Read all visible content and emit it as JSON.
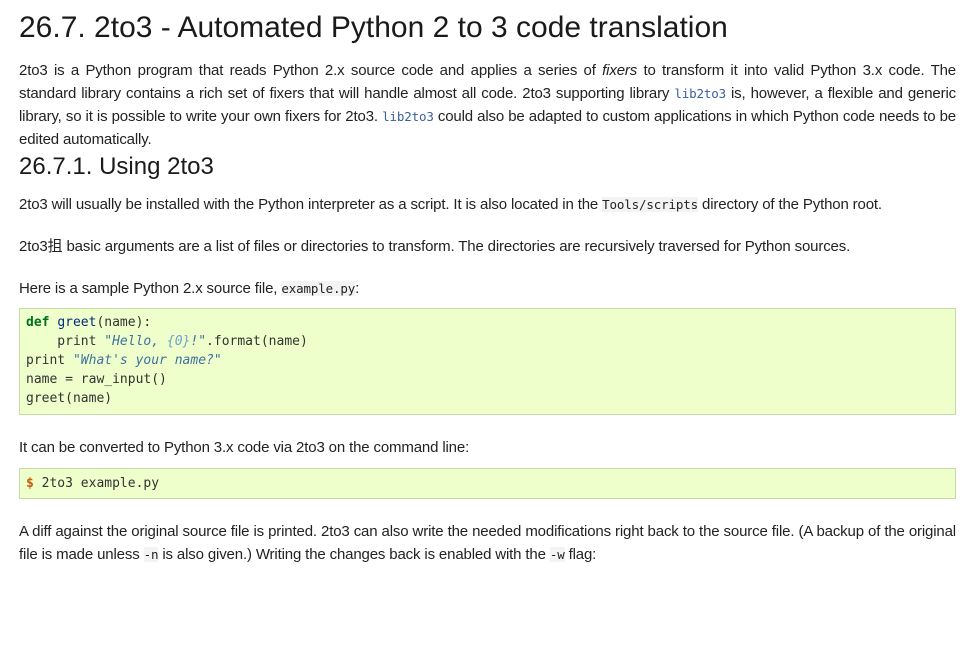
{
  "heading": "26.7. 2to3 - Automated Python 2 to 3 code translation",
  "intro": {
    "t1": "2to3 is a Python program that reads Python 2.x source code and applies a series of ",
    "fixers": "fixers",
    "t2": " to transform it into valid Python 3.x code. The standard library contains a rich set of fixers that will handle almost all code. 2to3 supporting library ",
    "lib1": "lib2to3",
    "t3": " is, however, a flexible and generic library, so it is possible to write your own fixers for 2to3. ",
    "lib2": "lib2to3",
    "t4": " could also be adapted to custom applications in which Python code needs to be edited automatically."
  },
  "subheading": "26.7.1. Using 2to3",
  "para1": {
    "t1": "2to3 will usually be installed with the Python interpreter as a script. It is also located in the ",
    "path": "Tools/scripts",
    "t2": " directory of the Python root."
  },
  "para2": "2to3抯 basic arguments are a list of files or directories to transform. The directories are recursively traversed for Python sources.",
  "para3": {
    "t1": "Here is a sample Python 2.x source file, ",
    "file": "example.py",
    "t2": ":"
  },
  "code1": {
    "l1_kw": "def",
    "l1_fn": "greet",
    "l1_rest": "(name):",
    "l2_indent": "    print ",
    "l2_str1": "\"Hello, ",
    "l2_interp": "{0}",
    "l2_str2": "!\"",
    "l2_rest": ".format(name)",
    "l3_kw": "print",
    "l3_str": "\"What's your name?\"",
    "l4": "name = raw_input()",
    "l5": "greet(name)"
  },
  "para4": "It can be converted to Python 3.x code via 2to3 on the command line:",
  "code2": {
    "prompt": "$",
    "cmd": " 2to3 example.py"
  },
  "para5": {
    "t1": "A diff against the original source file is printed. 2to3 can also write the needed modifications right back to the source file. (A backup of the original file is made unless ",
    "flag_n": "-n",
    "t2": " is also given.) Writing the changes back is enabled with the ",
    "flag_w": "-w",
    "t3": " flag:"
  }
}
